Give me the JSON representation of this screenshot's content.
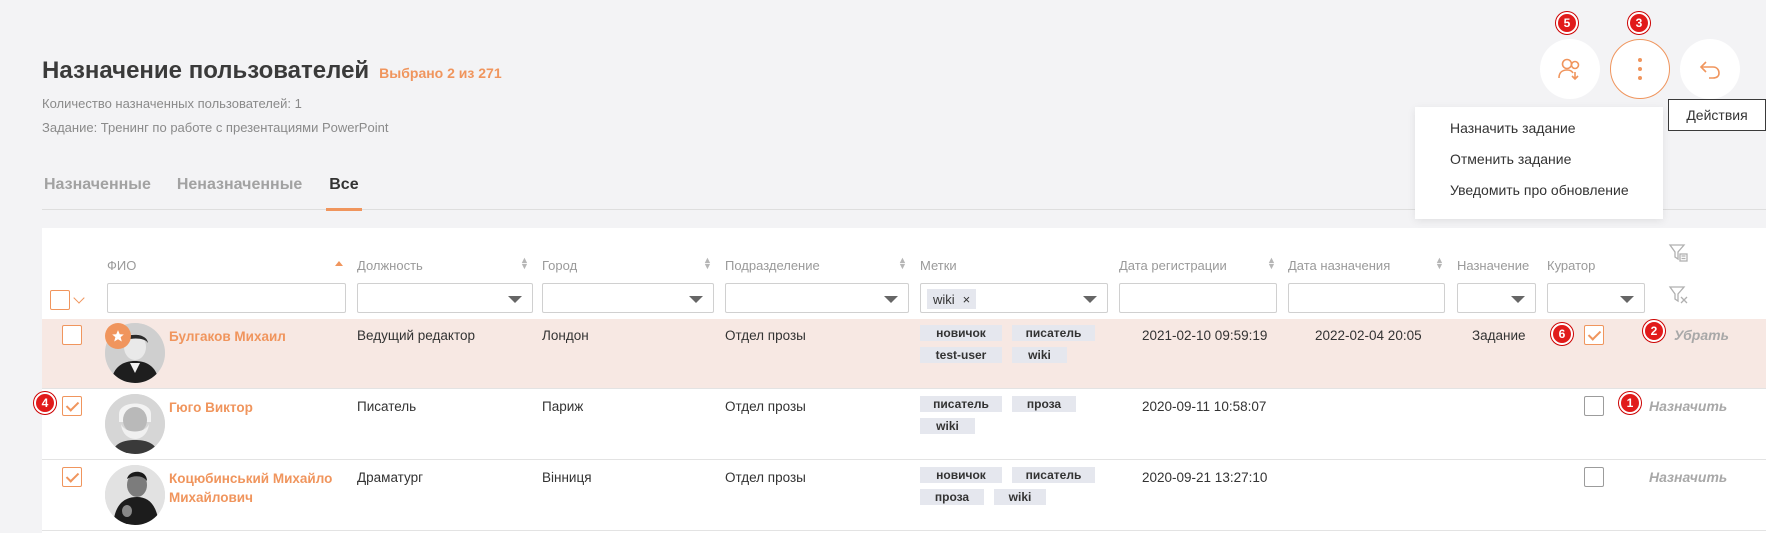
{
  "header": {
    "title": "Назначение пользователей",
    "selected_count": "Выбрано 2 из 271",
    "assigned_info": "Количество назначенных пользователей: 1",
    "task_info": "Задание: Тренинг по работе с презентациями PowerPoint"
  },
  "tabs": [
    {
      "label": "Назначенные"
    },
    {
      "label": "Неназначенные"
    },
    {
      "label": "Все"
    }
  ],
  "actions": {
    "tooltip": "Действия",
    "menu": [
      {
        "label": "Назначить задание"
      },
      {
        "label": "Отменить задание"
      },
      {
        "label": "Уведомить про обновление"
      }
    ]
  },
  "badges": {
    "b1": "1",
    "b2": "2",
    "b3": "3",
    "b4": "4",
    "b5": "5",
    "b6": "6"
  },
  "columns": {
    "name": "ФИО",
    "position": "Должность",
    "city": "Город",
    "department": "Подразделение",
    "tags": "Метки",
    "reg_date": "Дата регистрации",
    "assign_date": "Дата назначения",
    "assignment": "Назначение",
    "curator": "Куратор"
  },
  "filters": {
    "tags_selected": "wiki",
    "tags_remove": "×"
  },
  "rows": [
    {
      "name": "Булгаков Михаил",
      "position": "Ведущий редактор",
      "city": "Лондон",
      "department": "Отдел прозы",
      "tags": [
        "новичок",
        "писатель",
        "test-user",
        "wiki"
      ],
      "reg_date": "2021-02-10 09:59:19",
      "assign_date": "2022-02-04 20:05",
      "assignment": "Задание",
      "action": "Убрать"
    },
    {
      "name": "Гюго Виктор",
      "position": "Писатель",
      "city": "Париж",
      "department": "Отдел прозы",
      "tags": [
        "писатель",
        "проза",
        "wiki"
      ],
      "reg_date": "2020-09-11 10:58:07",
      "assign_date": "",
      "assignment": "",
      "action": "Назначить"
    },
    {
      "name": "Коцюбинський Михайло Михайлович",
      "position": "Драматург",
      "city": "Вінниця",
      "department": "Отдел прозы",
      "tags": [
        "новичок",
        "писатель",
        "проза",
        "wiki"
      ],
      "reg_date": "2020-09-21 13:27:10",
      "assign_date": "",
      "assignment": "",
      "action": "Назначить"
    }
  ],
  "colors": {
    "accent": "#f0955d",
    "badge": "#e11b1b",
    "highlight_row": "#f7e8e3"
  }
}
